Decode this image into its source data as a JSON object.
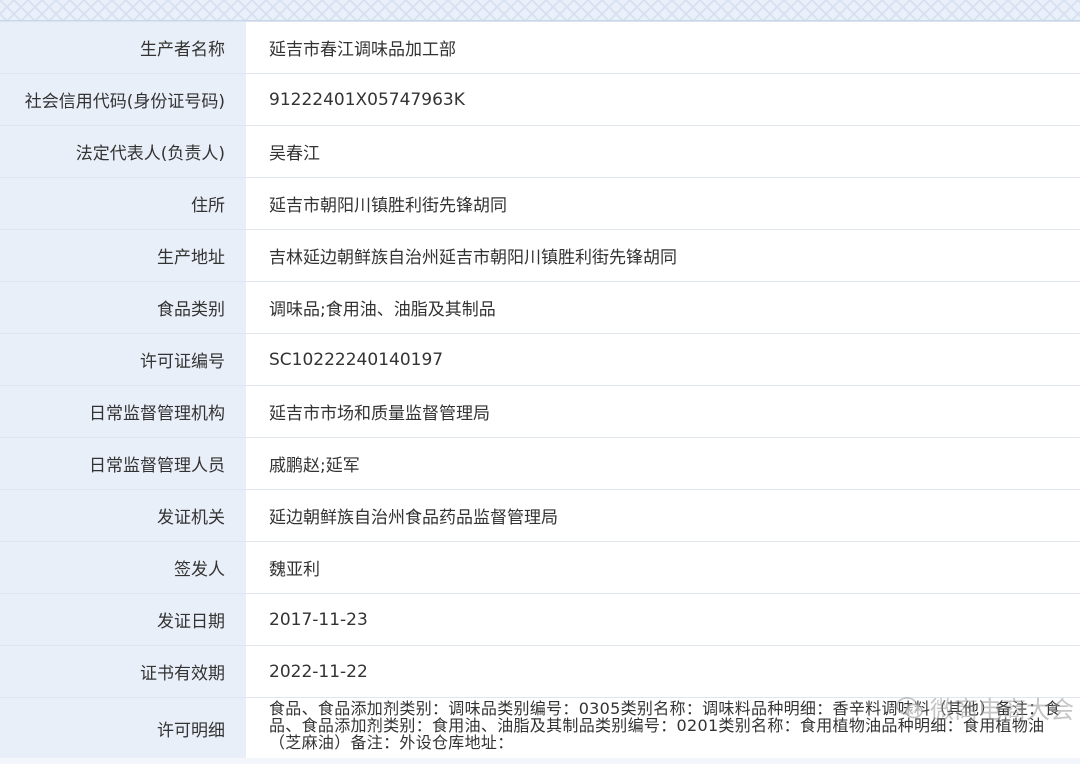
{
  "rows": [
    {
      "label": "生产者名称",
      "value": "延吉市春江调味品加工部"
    },
    {
      "label": "社会信用代码(身份证号码)",
      "value": "91222401X05747963K"
    },
    {
      "label": "法定代表人(负责人)",
      "value": "吴春江"
    },
    {
      "label": "住所",
      "value": "延吉市朝阳川镇胜利街先锋胡同"
    },
    {
      "label": "生产地址",
      "value": "吉林延边朝鲜族自治州延吉市朝阳川镇胜利街先锋胡同"
    },
    {
      "label": "食品类别",
      "value": "调味品;食用油、油脂及其制品"
    },
    {
      "label": "许可证编号",
      "value": "SC10222240140197"
    },
    {
      "label": "日常监督管理机构",
      "value": "延吉市市场和质量监督管理局"
    },
    {
      "label": "日常监督管理人员",
      "value": "戚鹏赵;延军"
    },
    {
      "label": "发证机关",
      "value": "延边朝鲜族自治州食品药品监督管理局"
    },
    {
      "label": "签发人",
      "value": "魏亚利"
    },
    {
      "label": "发证日期",
      "value": "2017-11-23"
    },
    {
      "label": "证书有效期",
      "value": "2022-11-22"
    },
    {
      "label": "许可明细",
      "value": "食品、食品添加剂类别：调味品类别编号：0305类别名称：调味料品种明细：香辛料调味料（其他）备注：食品、食品添加剂类别：食用油、油脂及其制品类别编号：0201类别名称：食用植物油品种明细：食用植物油（芝麻油）备注：外设仓库地址："
    }
  ],
  "watermark": {
    "text": "微商电商大会",
    "icon": "wechat-icon"
  }
}
